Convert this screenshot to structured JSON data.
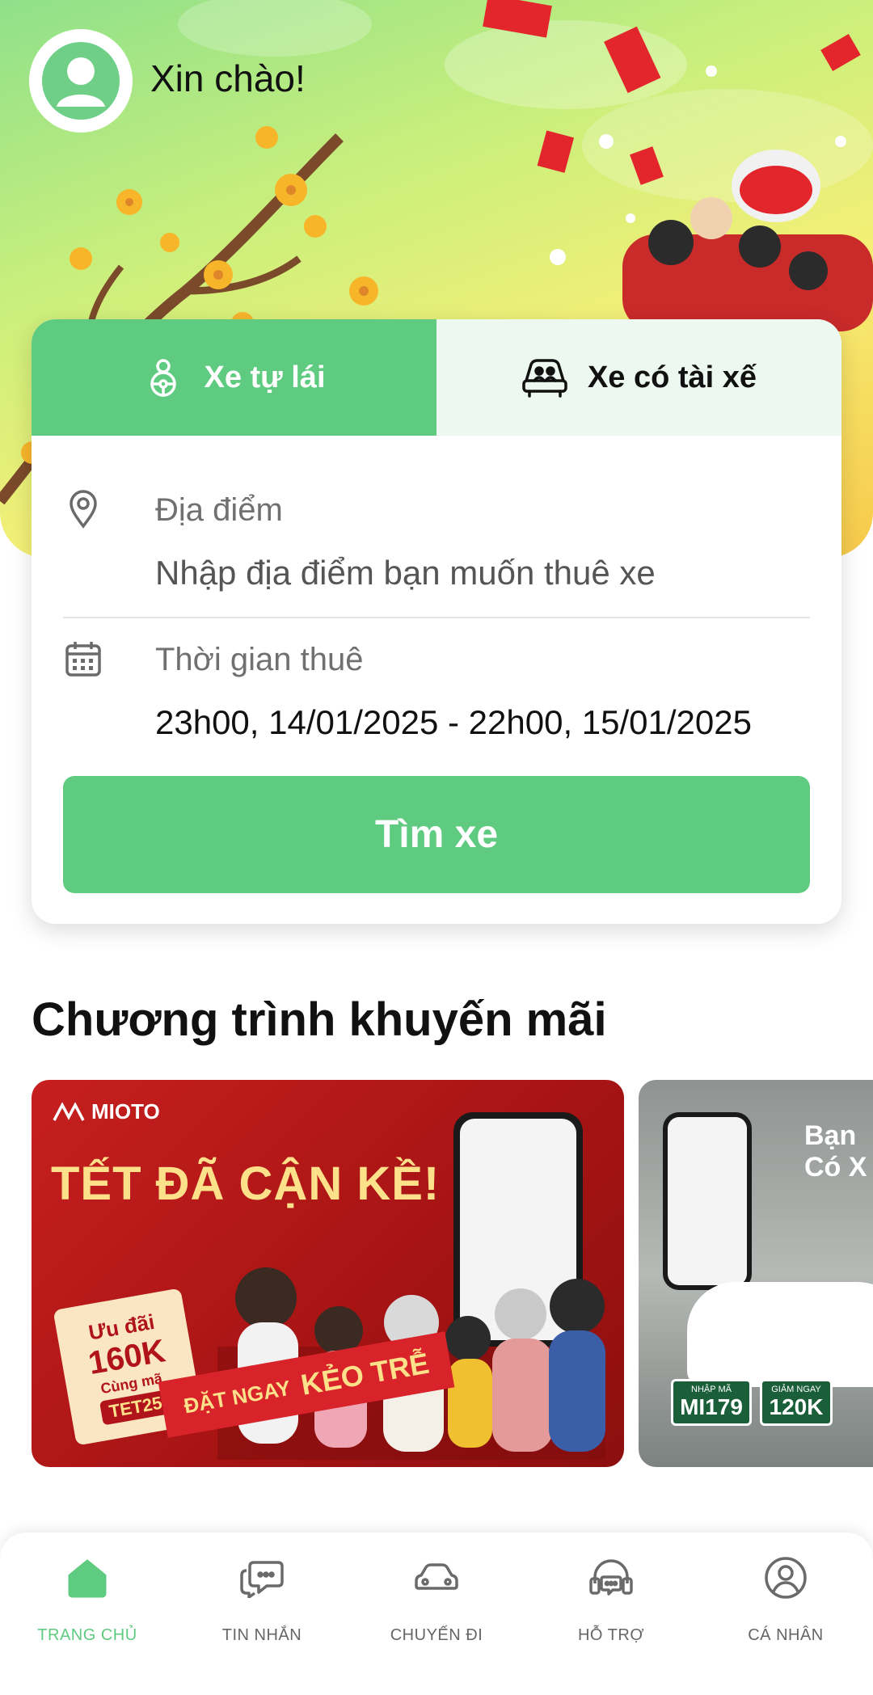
{
  "header": {
    "greeting": "Xin chào!"
  },
  "booking": {
    "tabs": [
      {
        "label": "Xe tự lái",
        "icon": "steering-person-icon",
        "active": true
      },
      {
        "label": "Xe có tài xế",
        "icon": "car-with-driver-icon",
        "active": false
      }
    ],
    "location": {
      "label": "Địa điểm",
      "placeholder": "Nhập địa điểm bạn muốn thuê xe"
    },
    "rental_time": {
      "label": "Thời gian thuê",
      "value": "23h00, 14/01/2025 - 22h00, 15/01/2025"
    },
    "search_button": "Tìm xe"
  },
  "promotions": {
    "title": "Chương trình khuyến mãi",
    "banners": [
      {
        "brand": "MIOTO",
        "headline": "TẾT ĐÃ CẬN KỀ!",
        "ticket_title": "Ưu đãi",
        "ticket_amount": "160K",
        "ticket_sub": "Cùng mã",
        "ticket_code": "TET25",
        "ribbon_left": "ĐẶT NGAY",
        "ribbon_right": "KẺO TRỄ"
      },
      {
        "headline_line1": "Bạn",
        "headline_line2": "Có X",
        "code_label": "NHẬP MÃ",
        "code": "MI179",
        "discount_label": "GIẢM NGAY",
        "discount": "120K"
      }
    ]
  },
  "bottom_nav": {
    "items": [
      {
        "label": "TRANG CHỦ",
        "icon": "home-icon",
        "active": true
      },
      {
        "label": "TIN NHẮN",
        "icon": "chat-icon",
        "active": false
      },
      {
        "label": "CHUYẾN ĐI",
        "icon": "car-icon",
        "active": false
      },
      {
        "label": "HỖ TRỢ",
        "icon": "headset-icon",
        "active": false
      },
      {
        "label": "CÁ NHÂN",
        "icon": "user-circle-icon",
        "active": false
      }
    ]
  },
  "colors": {
    "primary": "#5fcb80",
    "tab_inactive_bg": "#ecf8f0",
    "promo_red": "#c71f1f"
  }
}
